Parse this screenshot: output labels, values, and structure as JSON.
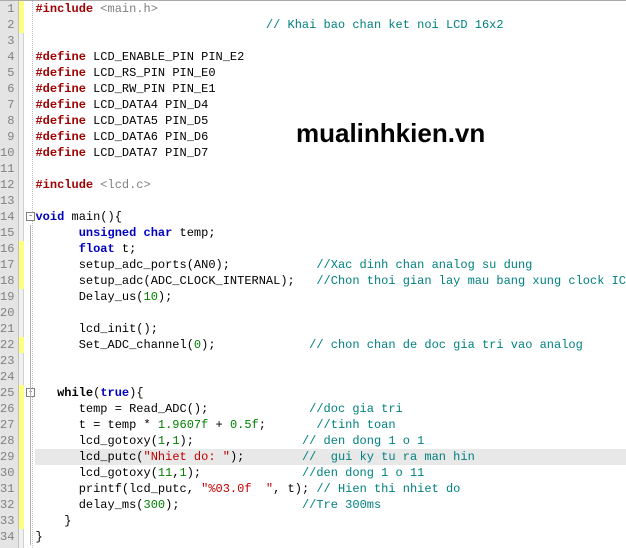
{
  "watermark": "mualinhkien.vn",
  "lines": [
    {
      "n": 1,
      "segs": [
        [
          "kw-red",
          "#include"
        ],
        [
          null,
          " "
        ],
        [
          "inc",
          "<main.h>"
        ]
      ]
    },
    {
      "n": 2,
      "segs": [
        [
          null,
          "                                "
        ],
        [
          "cmt",
          "// Khai bao chan ket noi LCD 16x2"
        ]
      ]
    },
    {
      "n": 3,
      "segs": []
    },
    {
      "n": 4,
      "segs": [
        [
          "kw-red",
          "#define"
        ],
        [
          null,
          " LCD_ENABLE_PIN PIN_E2"
        ]
      ]
    },
    {
      "n": 5,
      "segs": [
        [
          "kw-red",
          "#define"
        ],
        [
          null,
          " LCD_RS_PIN PIN_E0"
        ]
      ]
    },
    {
      "n": 6,
      "segs": [
        [
          "kw-red",
          "#define"
        ],
        [
          null,
          " LCD_RW_PIN PIN_E1"
        ]
      ]
    },
    {
      "n": 7,
      "segs": [
        [
          "kw-red",
          "#define"
        ],
        [
          null,
          " LCD_DATA4 PIN_D4"
        ]
      ]
    },
    {
      "n": 8,
      "segs": [
        [
          "kw-red",
          "#define"
        ],
        [
          null,
          " LCD_DATA5 PIN_D5"
        ]
      ]
    },
    {
      "n": 9,
      "segs": [
        [
          "kw-red",
          "#define"
        ],
        [
          null,
          " LCD_DATA6 PIN_D6"
        ]
      ]
    },
    {
      "n": 10,
      "segs": [
        [
          "kw-red",
          "#define"
        ],
        [
          null,
          " LCD_DATA7 PIN_D7"
        ]
      ]
    },
    {
      "n": 11,
      "segs": []
    },
    {
      "n": 12,
      "segs": [
        [
          "kw-red",
          "#include"
        ],
        [
          null,
          " "
        ],
        [
          "inc",
          "<lcd.c>"
        ]
      ]
    },
    {
      "n": 13,
      "segs": []
    },
    {
      "n": 14,
      "segs": [
        [
          "kw-blue",
          "void"
        ],
        [
          null,
          " main(){"
        ]
      ],
      "fold": true
    },
    {
      "n": 15,
      "segs": [
        [
          null,
          "      "
        ],
        [
          "kw-blue",
          "unsigned char"
        ],
        [
          null,
          " temp;"
        ]
      ]
    },
    {
      "n": 16,
      "segs": [
        [
          null,
          "      "
        ],
        [
          "kw-blue",
          "float"
        ],
        [
          null,
          " t;"
        ]
      ]
    },
    {
      "n": 17,
      "segs": [
        [
          null,
          "      setup_adc_ports(AN0);            "
        ],
        [
          "cmt",
          "//Xac dinh chan analog su dung"
        ]
      ]
    },
    {
      "n": 18,
      "segs": [
        [
          null,
          "      setup_adc(ADC_CLOCK_INTERNAL);   "
        ],
        [
          "cmt",
          "//Chon thoi gian lay mau bang xung clock IC"
        ]
      ]
    },
    {
      "n": 19,
      "segs": [
        [
          null,
          "      Delay_us("
        ],
        [
          "num",
          "10"
        ],
        [
          null,
          ");"
        ]
      ]
    },
    {
      "n": 20,
      "segs": []
    },
    {
      "n": 21,
      "segs": [
        [
          null,
          "      lcd_init();"
        ]
      ]
    },
    {
      "n": 22,
      "segs": [
        [
          null,
          "      Set_ADC_channel("
        ],
        [
          "num",
          "0"
        ],
        [
          null,
          ");             "
        ],
        [
          "cmt",
          "// chon chan de doc gia tri vao analog"
        ]
      ]
    },
    {
      "n": 23,
      "segs": []
    },
    {
      "n": 24,
      "segs": []
    },
    {
      "n": 25,
      "segs": [
        [
          null,
          "   "
        ],
        [
          "kw-bold",
          "while"
        ],
        [
          null,
          "("
        ],
        [
          "kw-blue",
          "true"
        ],
        [
          null,
          "){"
        ]
      ],
      "fold": true
    },
    {
      "n": 26,
      "segs": [
        [
          null,
          "      temp = Read_ADC();              "
        ],
        [
          "cmt",
          "//doc gia tri"
        ]
      ]
    },
    {
      "n": 27,
      "segs": [
        [
          null,
          "      t = temp * "
        ],
        [
          "num",
          "1.9607f"
        ],
        [
          null,
          " + "
        ],
        [
          "num",
          "0.5f"
        ],
        [
          null,
          ";       "
        ],
        [
          "cmt",
          "//tinh toan"
        ]
      ]
    },
    {
      "n": 28,
      "segs": [
        [
          null,
          "      lcd_gotoxy("
        ],
        [
          "num",
          "1"
        ],
        [
          null,
          ","
        ],
        [
          "num",
          "1"
        ],
        [
          null,
          ");               "
        ],
        [
          "cmt",
          "// den dong 1 o 1"
        ]
      ]
    },
    {
      "n": 29,
      "hl": true,
      "segs": [
        [
          null,
          "      lcd_putc("
        ],
        [
          "str",
          "\"Nhiet do: \""
        ],
        [
          null,
          ");        "
        ],
        [
          "cmt",
          "//  gui ky tu ra man hin"
        ]
      ]
    },
    {
      "n": 30,
      "segs": [
        [
          null,
          "      lcd_gotoxy("
        ],
        [
          "num",
          "11"
        ],
        [
          null,
          ","
        ],
        [
          "num",
          "1"
        ],
        [
          null,
          ");              "
        ],
        [
          "cmt",
          "//den dong 1 o 11"
        ]
      ]
    },
    {
      "n": 31,
      "segs": [
        [
          null,
          "      printf(lcd_putc, "
        ],
        [
          "str",
          "\"%03.0f  \""
        ],
        [
          null,
          ", t); "
        ],
        [
          "cmt",
          "// Hien thi nhiet do"
        ]
      ]
    },
    {
      "n": 32,
      "segs": [
        [
          null,
          "      delay_ms("
        ],
        [
          "num",
          "300"
        ],
        [
          null,
          ");                 "
        ],
        [
          "cmt",
          "//Tre 300ms"
        ]
      ]
    },
    {
      "n": 33,
      "segs": [
        [
          null,
          "    }"
        ]
      ]
    },
    {
      "n": 34,
      "segs": [
        [
          null,
          "}"
        ]
      ]
    }
  ],
  "marks": [
    {
      "start": 1,
      "end": 2
    },
    {
      "start": 16,
      "end": 18
    },
    {
      "start": 22,
      "end": 22
    },
    {
      "start": 25,
      "end": 33
    }
  ],
  "foldlines": [
    {
      "start": 15,
      "end": 34
    },
    {
      "start": 26,
      "end": 33
    }
  ]
}
